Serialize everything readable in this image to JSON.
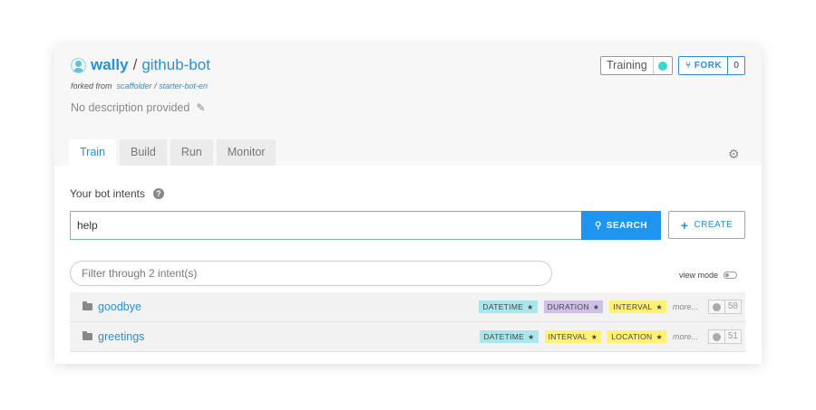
{
  "header": {
    "owner": "wally",
    "separator": "/",
    "repo": "github-bot",
    "forked_prefix": "forked from",
    "fork_source_owner": "scaffolder",
    "fork_source_sep": "/",
    "fork_source_repo": "starter-bot-en",
    "description": "No description provided",
    "training_label": "Training",
    "training_status_color": "#3fd6c9",
    "fork_label": "FORK",
    "fork_count": "0"
  },
  "tabs": [
    {
      "label": "Train",
      "active": true
    },
    {
      "label": "Build",
      "active": false
    },
    {
      "label": "Run",
      "active": false
    },
    {
      "label": "Monitor",
      "active": false
    }
  ],
  "main": {
    "section_title": "Your bot intents",
    "search_value": "help",
    "search_button": "SEARCH",
    "create_button": "CREATE",
    "filter_placeholder": "Filter through 2 intent(s)",
    "view_mode_label": "view mode"
  },
  "intents": [
    {
      "name": "goodbye",
      "tags": [
        {
          "label": "DATETIME",
          "color": "cyan"
        },
        {
          "label": "DURATION",
          "color": "purple"
        },
        {
          "label": "INTERVAL",
          "color": "yellow"
        }
      ],
      "more": "more...",
      "count": "58"
    },
    {
      "name": "greetings",
      "tags": [
        {
          "label": "DATETIME",
          "color": "cyan"
        },
        {
          "label": "INTERVAL",
          "color": "yellow"
        },
        {
          "label": "LOCATION",
          "color": "yellow"
        }
      ],
      "more": "more...",
      "count": "51"
    }
  ]
}
